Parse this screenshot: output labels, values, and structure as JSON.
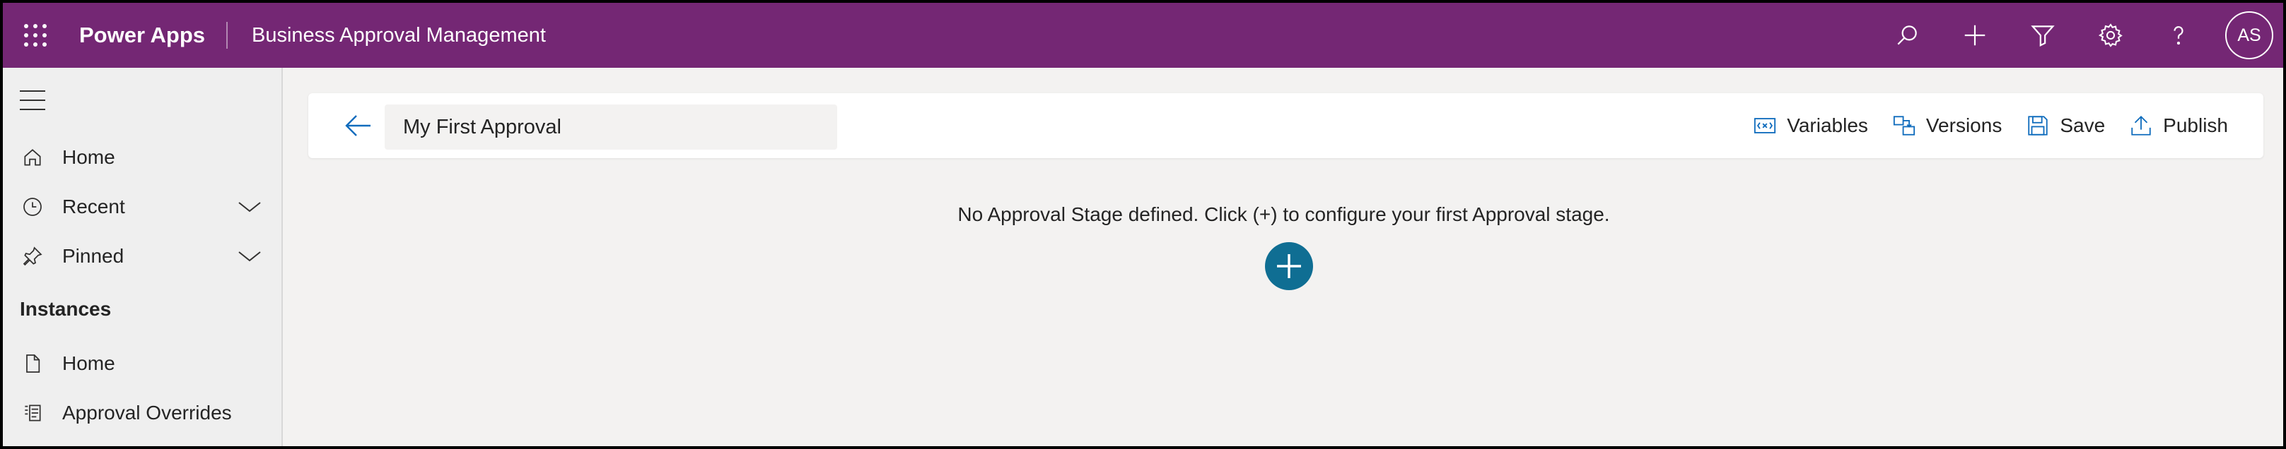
{
  "header": {
    "brand": "Power Apps",
    "app_title": "Business Approval Management",
    "icons": [
      "search-icon",
      "plus-icon",
      "filter-icon",
      "gear-icon",
      "help-icon"
    ],
    "avatar_initials": "AS",
    "bg_color": "#742774"
  },
  "sidebar": {
    "items": [
      {
        "label": "Home",
        "icon": "home-icon"
      },
      {
        "label": "Recent",
        "icon": "clock-icon",
        "expandable": true
      },
      {
        "label": "Pinned",
        "icon": "pin-icon",
        "expandable": true
      }
    ],
    "section_title": "Instances",
    "section_items": [
      {
        "label": "Home",
        "icon": "document-icon"
      },
      {
        "label": "Approval Overrides",
        "icon": "overrides-icon"
      }
    ]
  },
  "commandbar": {
    "name_value": "My First Approval",
    "actions": {
      "variables": "Variables",
      "versions": "Versions",
      "save": "Save",
      "publish": "Publish"
    }
  },
  "main": {
    "empty_message": "No Approval Stage defined. Click (+) to configure your first Approval stage.",
    "add_button_color": "#0f6e93"
  }
}
